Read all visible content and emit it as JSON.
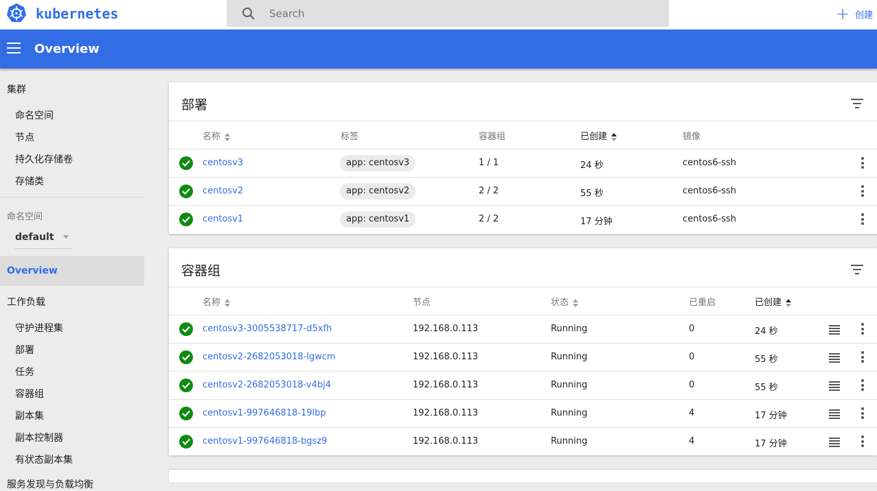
{
  "brand": {
    "name": "kubernetes"
  },
  "search": {
    "placeholder": "Search"
  },
  "header": {
    "create_label": "创建",
    "title": "Overview"
  },
  "sidebar": {
    "cluster": {
      "heading": "集群",
      "items": [
        "命名空间",
        "节点",
        "持久化存储卷",
        "存储类"
      ]
    },
    "namespace": {
      "label": "命名空间",
      "selected": "default"
    },
    "overview": "Overview",
    "workloads": {
      "heading": "工作负载",
      "items": [
        "守护进程集",
        "部署",
        "任务",
        "容器组",
        "副本集",
        "副本控制器",
        "有状态副本集"
      ]
    },
    "cutoff_heading": "服务发现与负载均衡"
  },
  "deployments": {
    "title": "部署",
    "columns": [
      "名称",
      "标签",
      "容器组",
      "已创建",
      "镜像"
    ],
    "rows": [
      {
        "name": "centosv3",
        "label": "app: centosv3",
        "pods": "1 / 1",
        "created": "24 秒",
        "image": "centos6-ssh"
      },
      {
        "name": "centosv2",
        "label": "app: centosv2",
        "pods": "2 / 2",
        "created": "55 秒",
        "image": "centos6-ssh"
      },
      {
        "name": "centosv1",
        "label": "app: centosv1",
        "pods": "2 / 2",
        "created": "17 分钟",
        "image": "centos6-ssh"
      }
    ]
  },
  "pods": {
    "title": "容器组",
    "columns": [
      "名称",
      "节点",
      "状态",
      "已重启",
      "已创建"
    ],
    "rows": [
      {
        "name": "centosv3-3005538717-d5xfh",
        "node": "192.168.0.113",
        "status": "Running",
        "restarts": "0",
        "created": "24 秒"
      },
      {
        "name": "centosv2-2682053018-lgwcm",
        "node": "192.168.0.113",
        "status": "Running",
        "restarts": "0",
        "created": "55 秒"
      },
      {
        "name": "centosv2-2682053018-v4bj4",
        "node": "192.168.0.113",
        "status": "Running",
        "restarts": "0",
        "created": "55 秒"
      },
      {
        "name": "centosv1-997646818-19lbp",
        "node": "192.168.0.113",
        "status": "Running",
        "restarts": "4",
        "created": "17 分钟"
      },
      {
        "name": "centosv1-997646818-bgsz9",
        "node": "192.168.0.113",
        "status": "Running",
        "restarts": "4",
        "created": "17 分钟"
      }
    ]
  },
  "colors": {
    "accent": "#326de6",
    "status_ok": "#0d8b11"
  }
}
